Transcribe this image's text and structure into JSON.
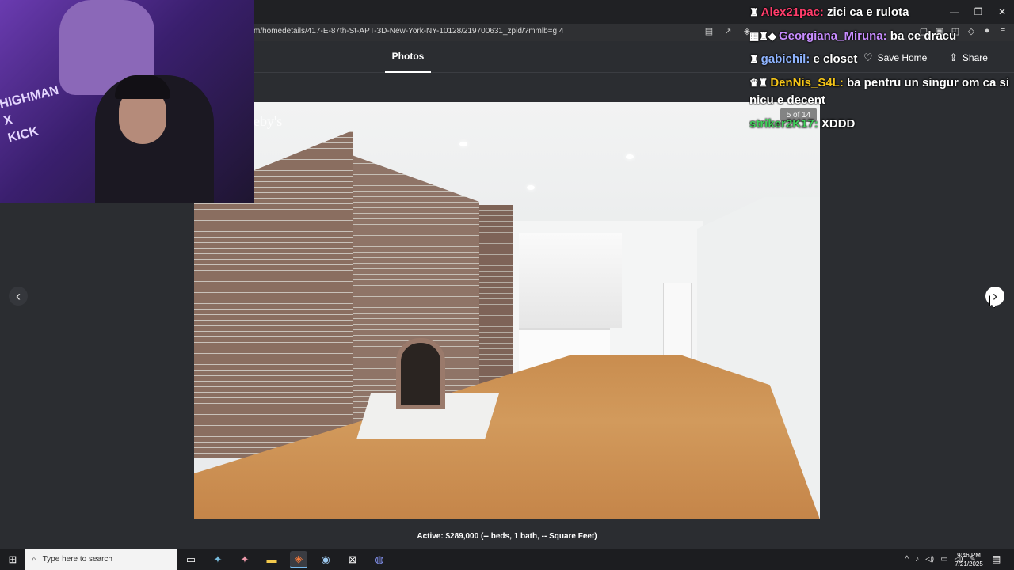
{
  "browser": {
    "url": "m/homedetails/417-E-87th-St-APT-3D-New-York-NY-10128/219700631_zpid/?mmlb=g,4",
    "window_controls": [
      "—",
      "❐",
      "✕"
    ]
  },
  "gallery": {
    "tab_label": "Photos",
    "save_label": "Save Home",
    "share_label": "Share",
    "photo_counter": "5 of 14",
    "watermark": "eby's",
    "caption": "Active: $289,000 (-- beds, 1 bath, -- Square Feet)"
  },
  "icons": {
    "prev": "‹",
    "next": "›",
    "heart": "♡",
    "share": "⇪",
    "search": "⌕",
    "windows": "⊞"
  },
  "webcam": {
    "overlay_text": "HIGHMAN\nX\nKICK"
  },
  "chat": [
    {
      "user": "Alex21pac:",
      "message": " zici ca e rulota"
    },
    {
      "user": "Georgiana_Miruna:",
      "message": " ba ce dracu"
    },
    {
      "user": "gabichil:",
      "message": " e closet"
    },
    {
      "user": "DenNis_S4L:",
      "message": " ba pentru un singur om ca si nicu e decent"
    },
    {
      "user": "striker2K17:",
      "message": " XDDD"
    }
  ],
  "taskbar": {
    "search_placeholder": "Type here to search",
    "time": "9:46 PM",
    "date": "7/21/2025"
  },
  "colors": {
    "page_bg": "#2b2d31",
    "accent": "#ffffff"
  }
}
